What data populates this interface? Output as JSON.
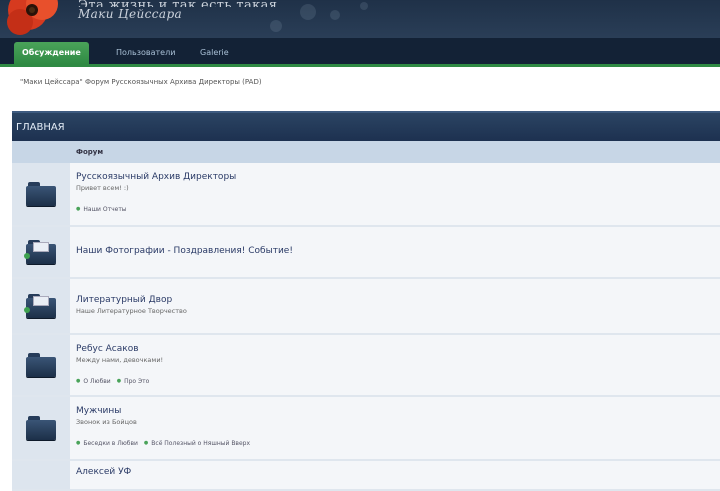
{
  "header": {
    "title_line1": "Эта жизнь и так есть такая",
    "title_line2": "Маки Цейссара"
  },
  "nav": {
    "tabs": [
      {
        "label": "Обсуждение",
        "active": true
      },
      {
        "label": "Пользователи",
        "active": false
      },
      {
        "label": "Galerie",
        "active": false
      }
    ]
  },
  "breadcrumb": "\"Маки Цейссара\" Форум Русскоязычных Архива Директоры (PAD)",
  "category": {
    "title": "ГЛАВНАЯ",
    "column_header": "Форум",
    "forums": [
      {
        "title": "Русскоязычный Архив Директоры",
        "desc": "Привет всем! :)",
        "subforums": [
          "Наши Отчеты"
        ]
      },
      {
        "title": "Наши Фотографии - Поздравления! Событие!",
        "desc": "",
        "subforums": []
      },
      {
        "title": "Литературный Двор",
        "desc": "Наше Литературное Творчество",
        "subforums": []
      },
      {
        "title": "Ребус Асаков",
        "desc": "Между нами, девочками!",
        "subforums": [
          "О Любви",
          "Про Это"
        ]
      },
      {
        "title": "Мужчины",
        "desc": "Звонок из Бойцов",
        "subforums": [
          "Беседки в Любви",
          "Всё Полезный о Няшный Вверх"
        ]
      },
      {
        "title": "Алексей УФ",
        "desc": "",
        "subforums": []
      }
    ]
  }
}
